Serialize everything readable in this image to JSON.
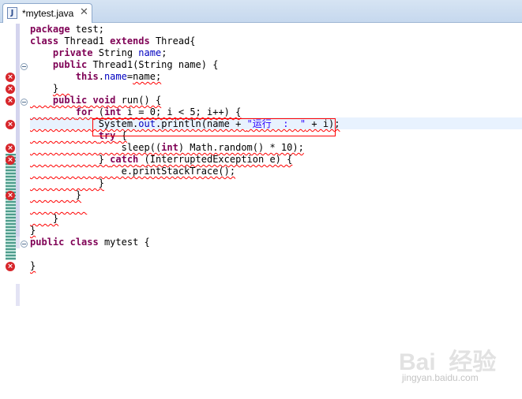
{
  "tab": {
    "title": "*mytest.java",
    "icon": "java-file-icon",
    "close_icon": "close-icon"
  },
  "code": [
    {
      "t": "package test;"
    },
    {
      "t": "class Thread1 extends Thread{"
    },
    {
      "t": "    private String name;"
    },
    {
      "t": "    public Thread1(String name) {"
    },
    {
      "t": "        this.name=name;"
    },
    {
      "t": "    }"
    },
    {
      "t": "    public void run() {"
    },
    {
      "t": "        for (int i = 0; i < 5; i++) {"
    },
    {
      "t": "            System.out.println(name + \"运行  :  \" + i);"
    },
    {
      "t": "            try {"
    },
    {
      "t": "                sleep((int) Math.random() * 10);"
    },
    {
      "t": "            } catch (InterruptedException e) {"
    },
    {
      "t": "                e.printStackTrace();"
    },
    {
      "t": "            }"
    },
    {
      "t": "        }"
    },
    {
      "t": ""
    },
    {
      "t": "    }"
    },
    {
      "t": "}"
    },
    {
      "t": "public class mytest {"
    },
    {
      "t": ""
    },
    {
      "t": "}"
    }
  ],
  "error_icon_glyph": "×",
  "watermark": {
    "brand": "Bai  经验",
    "url": "jingyan.baidu.com"
  },
  "colors": {
    "keyword": "#7f0055",
    "string": "#2a00ff",
    "field": "#0000c0",
    "error": "#d7262b",
    "current_line": "#e8f2fe",
    "tab_bar": "#c6d8ee"
  }
}
